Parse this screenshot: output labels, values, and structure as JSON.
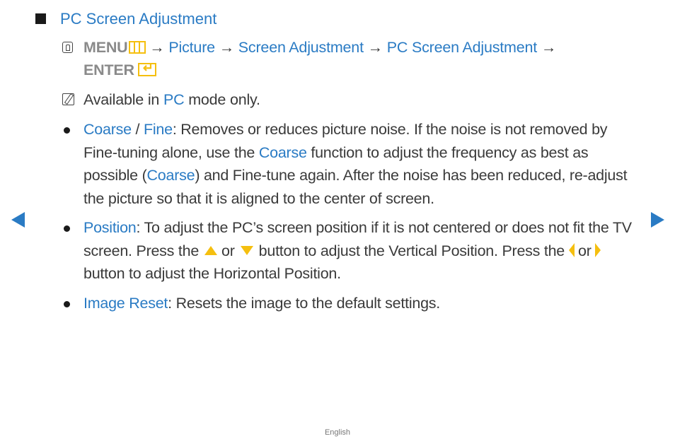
{
  "heading": {
    "icon": "black-square-icon",
    "title": "PC Screen Adjustment"
  },
  "path": {
    "icon": "remote-hand-icon",
    "menu": "MENU",
    "menu_icon": "menu-icon",
    "arrow": "→",
    "steps": [
      "Picture",
      "Screen Adjustment",
      "PC Screen Adjustment"
    ],
    "enter": "ENTER",
    "enter_icon": "enter-icon"
  },
  "note": {
    "icon": "note-icon",
    "before": "Available in ",
    "highlight": "PC",
    "after": " mode only."
  },
  "items": [
    {
      "term1": "Coarse",
      "sep": " / ",
      "term2": "Fine",
      "text1": ": Removes or reduces picture noise. If the noise is not removed by Fine-tuning alone, use the ",
      "term3": "Coarse",
      "text2": " function to adjust the frequency as best as possible (",
      "term4": "Coarse",
      "text3": ") and Fine-tune again. After the noise has been reduced, re-adjust the picture so that it is aligned to the center of screen."
    },
    {
      "term": "Position",
      "text1": ": To adjust the PC’s screen position if it is not centered or does not fit the TV screen. Press the",
      "or1": "or",
      "text2": "button to adjust the Vertical Position. Press the",
      "or2": "or",
      "text3": "button to adjust the Horizontal Position."
    },
    {
      "term": "Image Reset",
      "text": ": Resets the image to the default settings."
    }
  ],
  "nav": {
    "prev": "previous-page",
    "next": "next-page"
  },
  "footer": {
    "language": "English"
  },
  "colors": {
    "accent": "#2a7bc4",
    "icon_yellow": "#f5bf0f",
    "text": "#3a3a3a",
    "muted": "#8a8a8a"
  }
}
